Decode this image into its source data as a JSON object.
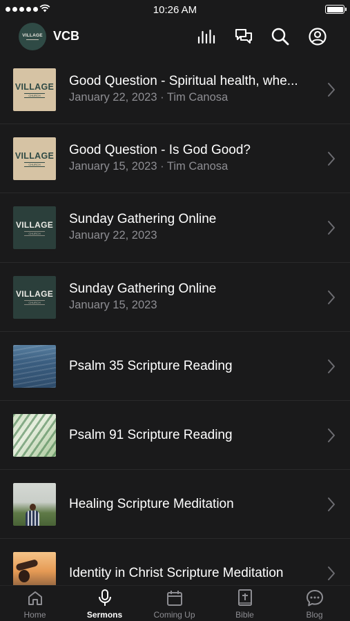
{
  "status_bar": {
    "time": "10:26 AM",
    "battery_level": 1.0
  },
  "header": {
    "app_title": "VCB",
    "logo_text": "VILLAGE",
    "icons": [
      "audio-bars-icon",
      "chat-icon",
      "search-icon",
      "profile-icon"
    ]
  },
  "sermons": [
    {
      "title": "Good Question - Spiritual health, whe...",
      "subtitle": "January 22, 2023 · Tim Canosa",
      "thumb_style": "beige",
      "thumb_text": "VILLAGE",
      "thumb_subtext": "CHURCH"
    },
    {
      "title": "Good Question - Is God Good?",
      "subtitle": "January 15, 2023 · Tim Canosa",
      "thumb_style": "beige",
      "thumb_text": "VILLAGE",
      "thumb_subtext": "CHURCH"
    },
    {
      "title": "Sunday Gathering Online",
      "subtitle": "January 22, 2023",
      "thumb_style": "green",
      "thumb_text": "VILLAGE",
      "thumb_subtext": "CHURCH"
    },
    {
      "title": "Sunday Gathering Online",
      "subtitle": "January 15, 2023",
      "thumb_style": "green",
      "thumb_text": "VILLAGE",
      "thumb_subtext": "CHURCH"
    },
    {
      "title": "Psalm 35 Scripture Reading",
      "thumb_style": "water"
    },
    {
      "title": "Psalm 91 Scripture Reading",
      "thumb_style": "leaf"
    },
    {
      "title": "Healing Scripture Meditation",
      "thumb_style": "person"
    },
    {
      "title": "Identity in Christ Scripture Meditation",
      "thumb_style": "sunset"
    }
  ],
  "tabs": [
    {
      "label": "Home",
      "icon": "home-icon",
      "active": false
    },
    {
      "label": "Sermons",
      "icon": "microphone-icon",
      "active": true
    },
    {
      "label": "Coming Up",
      "icon": "calendar-icon",
      "active": false
    },
    {
      "label": "Bible",
      "icon": "bible-icon",
      "active": false
    },
    {
      "label": "Blog",
      "icon": "blog-chat-icon",
      "active": false
    }
  ],
  "colors": {
    "background": "#1a1a1b",
    "text_primary": "#ffffff",
    "text_secondary": "#8e8e93",
    "logo_green": "#2f4a45"
  }
}
